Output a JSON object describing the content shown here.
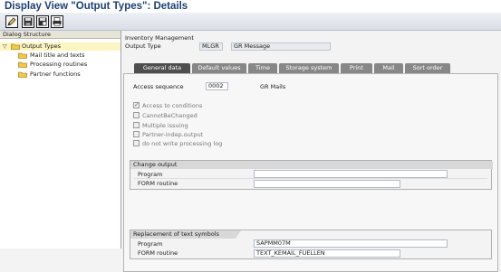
{
  "window": {
    "title": "Display View \"Output Types\": Details"
  },
  "toolbar": {
    "buttons": [
      "edit-icon",
      "save-icon",
      "local-save-icon",
      "print-icon"
    ]
  },
  "dialog_structure": {
    "header": "Dialog Structure",
    "items": [
      {
        "label": "Output Types",
        "selected": true,
        "expanded": true
      },
      {
        "label": "Mail title and texts",
        "selected": false
      },
      {
        "label": "Processing routines",
        "selected": false
      },
      {
        "label": "Partner functions",
        "selected": false
      }
    ]
  },
  "details": {
    "application": "Inventory Management",
    "output_type_label": "Output Type",
    "output_type_value": "MLGR",
    "output_type_desc": "GR Message",
    "tabs": [
      "General data",
      "Default values",
      "Time",
      "Storage system",
      "Print",
      "Mail",
      "Sort order"
    ],
    "active_tab": "General data",
    "access_sequence_label": "Access sequence",
    "access_sequence_value": "0002",
    "access_sequence_desc": "GR Mails",
    "checkboxes": [
      {
        "label": "Access to conditions",
        "checked": true
      },
      {
        "label": "CannotBeChanged",
        "checked": false
      },
      {
        "label": "Multiple issuing",
        "checked": false
      },
      {
        "label": "Partner-indep.output",
        "checked": false
      },
      {
        "label": "do not write processing log",
        "checked": false
      }
    ],
    "change_output": {
      "title": "Change output",
      "program_label": "Program",
      "program_value": "",
      "form_label": "FORM routine",
      "form_value": ""
    },
    "replacement": {
      "title": "Replacement of text symbols",
      "program_label": "Program",
      "program_value": "SAPMM07M",
      "form_label": "FORM routine",
      "form_value": "TEXT_KEMAIL_FUELLEN"
    }
  }
}
